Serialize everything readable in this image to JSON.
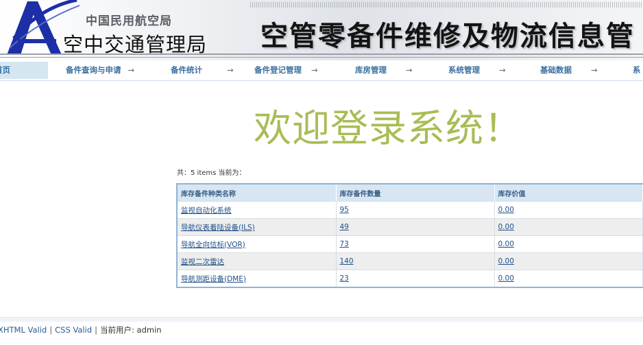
{
  "header": {
    "org_cn": "中国民用航空局",
    "org_name": "空中交通管理局",
    "system_title": "空管零备件维修及物流信息管"
  },
  "nav": {
    "items": [
      {
        "label": "首页",
        "active": true
      },
      {
        "label": "备件查询与申请"
      },
      {
        "label": "备件统计"
      },
      {
        "label": "备件登记管理"
      },
      {
        "label": "库房管理"
      },
      {
        "label": "系统管理"
      },
      {
        "label": "基础数据"
      },
      {
        "label": "系"
      }
    ],
    "arrow": "→"
  },
  "main": {
    "welcome": "欢迎登录系统！",
    "pager_info": "共：5 items 当前为："
  },
  "table": {
    "headers": [
      "库存备件种类名称",
      "库存备件数量",
      "库存价值"
    ],
    "rows": [
      [
        "监视自动化系统",
        "95",
        "0.00"
      ],
      [
        "导航仪表着陆设备(ILS)",
        "49",
        "0.00"
      ],
      [
        "导航全向信标(VOR)",
        "73",
        "0.00"
      ],
      [
        "监视二次雷达",
        "140",
        "0.00"
      ],
      [
        "导航测距设备(DME)",
        "23",
        "0.00"
      ]
    ]
  },
  "footer": {
    "xhtml": "XHTML Valid",
    "css": "CSS Valid",
    "separator": "|",
    "user_label": "当前用户:",
    "user": "admin"
  },
  "colors": {
    "welcome": "#a8bd54",
    "nav_text": "#3c6fa0",
    "table_header_bg": "#d7e6f2",
    "table_border": "#8fb3d3",
    "link": "#1d4f8a"
  }
}
